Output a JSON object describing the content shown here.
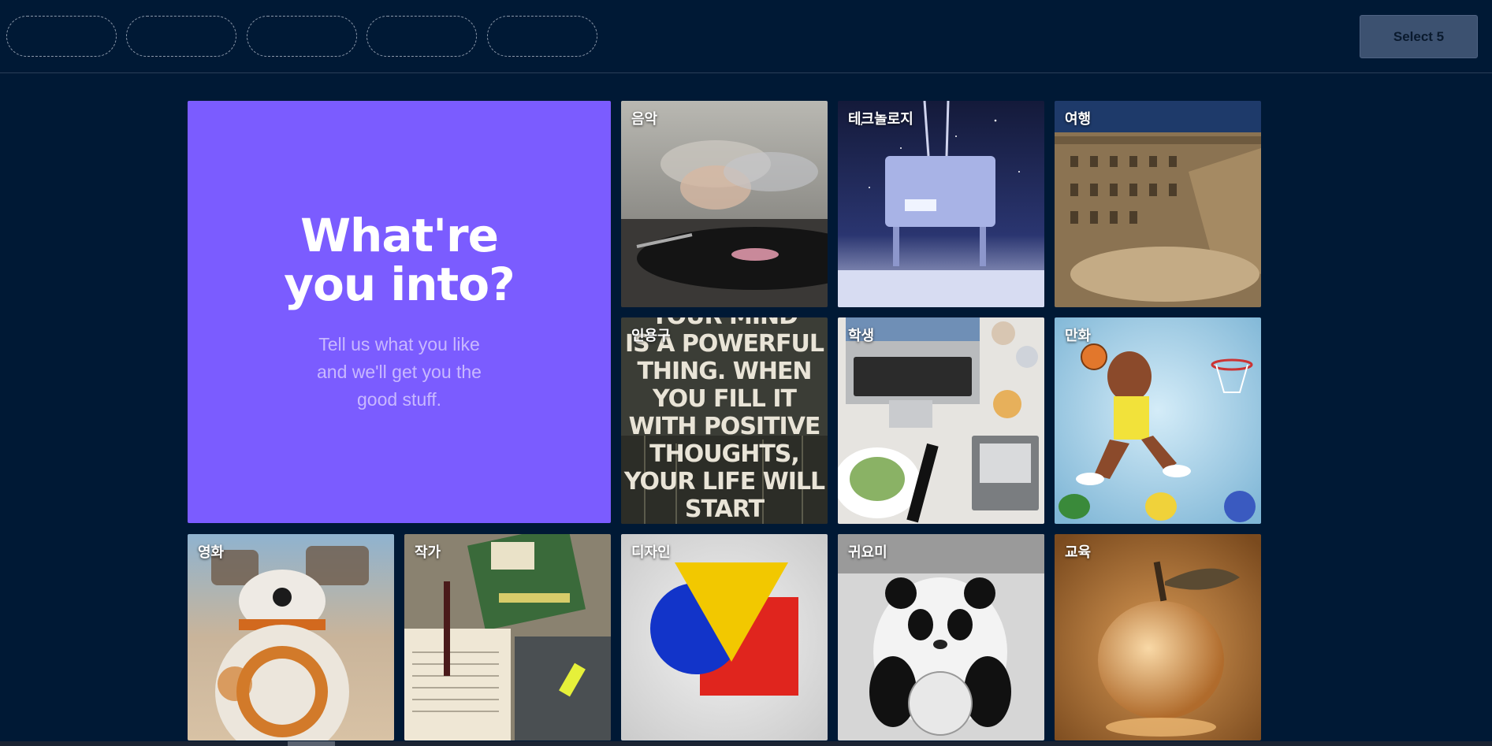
{
  "header": {
    "slot_count": 5,
    "select_button_label": "Select 5"
  },
  "hero": {
    "title": "What're you into?",
    "subtitle": "Tell us what you like and we'll get you the good stuff."
  },
  "topics": [
    {
      "label": "음악",
      "icon": "turntable-photo"
    },
    {
      "label": "테크놀로지",
      "icon": "antarctic-station-photo"
    },
    {
      "label": "여행",
      "icon": "ancient-theater-photo"
    },
    {
      "label": "인용구",
      "icon": "quote-poster-photo",
      "quote": [
        "YOUR MIND",
        "IS A POWERFUL",
        "THING. WHEN",
        "YOU FILL IT",
        "WITH POSITIVE",
        "THOUGHTS,",
        "YOUR LIFE WILL",
        "START"
      ]
    },
    {
      "label": "학생",
      "icon": "laptop-desk-photo"
    },
    {
      "label": "만화",
      "icon": "cartoon-ape-basketball"
    },
    {
      "label": "영화",
      "icon": "droid-robot-photo"
    },
    {
      "label": "작가",
      "icon": "books-pen-photo"
    },
    {
      "label": "디자인",
      "icon": "geometric-shapes-art"
    },
    {
      "label": "귀요미",
      "icon": "panda-cub-photo"
    },
    {
      "label": "교육",
      "icon": "glass-apple-photo"
    }
  ],
  "colors": {
    "background": "#001935",
    "hero": "#7b5cff",
    "select_button": "#3c5170"
  }
}
